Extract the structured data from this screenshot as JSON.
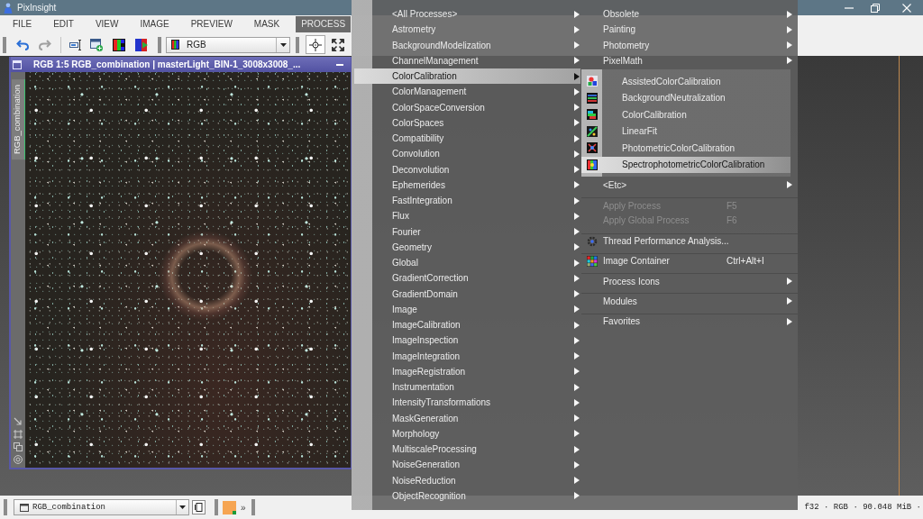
{
  "window": {
    "title": "PixInsight"
  },
  "menu_bar": [
    {
      "label": "FILE",
      "selected": false
    },
    {
      "label": "EDIT",
      "selected": false
    },
    {
      "label": "VIEW",
      "selected": false
    },
    {
      "label": "IMAGE",
      "selected": false
    },
    {
      "label": "PREVIEW",
      "selected": false
    },
    {
      "label": "MASK",
      "selected": false
    },
    {
      "label": "PROCESS",
      "selected": true
    }
  ],
  "toolbar": {
    "undo": {
      "disabled": false
    },
    "redo": {
      "disabled": true
    },
    "channel_selector": {
      "value": "RGB"
    },
    "tools": [
      {
        "selected": true
      },
      {
        "selected": false
      }
    ]
  },
  "image_window": {
    "title": "RGB 1:5 RGB_combination | masterLight_BIN-1_3008x3008_...",
    "side_tab": "RGB_combination"
  },
  "process_menu": {
    "column_1": [
      {
        "label": "<All Processes>",
        "selected": false
      },
      {
        "label": "Astrometry",
        "selected": false
      },
      {
        "label": "BackgroundModelization",
        "selected": false
      },
      {
        "label": "ChannelManagement",
        "selected": false
      },
      {
        "label": "ColorCalibration",
        "selected": true
      },
      {
        "label": "ColorManagement",
        "selected": false
      },
      {
        "label": "ColorSpaceConversion",
        "selected": false
      },
      {
        "label": "ColorSpaces",
        "selected": false
      },
      {
        "label": "Compatibility",
        "selected": false
      },
      {
        "label": "Convolution",
        "selected": false
      },
      {
        "label": "Deconvolution",
        "selected": false
      },
      {
        "label": "Ephemerides",
        "selected": false
      },
      {
        "label": "FastIntegration",
        "selected": false
      },
      {
        "label": "Flux",
        "selected": false
      },
      {
        "label": "Fourier",
        "selected": false
      },
      {
        "label": "Geometry",
        "selected": false
      },
      {
        "label": "Global",
        "selected": false
      },
      {
        "label": "GradientCorrection",
        "selected": false
      },
      {
        "label": "GradientDomain",
        "selected": false
      },
      {
        "label": "Image",
        "selected": false
      },
      {
        "label": "ImageCalibration",
        "selected": false
      },
      {
        "label": "ImageInspection",
        "selected": false
      },
      {
        "label": "ImageIntegration",
        "selected": false
      },
      {
        "label": "ImageRegistration",
        "selected": false
      },
      {
        "label": "Instrumentation",
        "selected": false
      },
      {
        "label": "IntensityTransformations",
        "selected": false
      },
      {
        "label": "MaskGeneration",
        "selected": false
      },
      {
        "label": "Morphology",
        "selected": false
      },
      {
        "label": "MultiscaleProcessing",
        "selected": false
      },
      {
        "label": "NoiseGeneration",
        "selected": false
      },
      {
        "label": "NoiseReduction",
        "selected": false
      },
      {
        "label": "ObjectRecognition",
        "selected": false
      }
    ],
    "column_2": {
      "upper": [
        {
          "label": "Obsolete",
          "kind": "submenu",
          "selected": false,
          "disabled": false,
          "separator_before": false
        },
        {
          "label": "Painting",
          "kind": "submenu",
          "selected": false,
          "disabled": false,
          "separator_before": false
        },
        {
          "label": "Photometry",
          "kind": "submenu",
          "selected": false,
          "disabled": false,
          "separator_before": false
        },
        {
          "label": "PixelMath",
          "kind": "submenu",
          "selected": false,
          "disabled": false,
          "separator_before": false
        }
      ],
      "lower": [
        {
          "label": "<Etc>",
          "kind": "submenu",
          "selected": false,
          "disabled": false,
          "separator_before": false
        },
        {
          "label": "Apply Process",
          "kind": "action",
          "shortcut": "F5",
          "selected": false,
          "disabled": true,
          "separator_before": true
        },
        {
          "label": "Apply Global Process",
          "kind": "action",
          "shortcut": "F6",
          "selected": false,
          "disabled": true,
          "separator_before": false
        },
        {
          "label": "Thread Performance Analysis...",
          "kind": "tool",
          "selected": false,
          "disabled": false,
          "separator_before": true
        },
        {
          "label": "Image Container",
          "kind": "tool",
          "shortcut": "Ctrl+Alt+I",
          "selected": false,
          "disabled": false,
          "separator_before": true
        },
        {
          "label": "Process Icons",
          "kind": "submenu",
          "selected": false,
          "disabled": false,
          "separator_before": true
        },
        {
          "label": "Modules",
          "kind": "submenu",
          "selected": false,
          "disabled": false,
          "separator_before": true
        },
        {
          "label": "Favorites",
          "kind": "submenu",
          "selected": false,
          "disabled": false,
          "separator_before": true
        }
      ]
    },
    "submenu": [
      {
        "label": "AssistedColorCalibration",
        "selected": false
      },
      {
        "label": "BackgroundNeutralization",
        "selected": false
      },
      {
        "label": "ColorCalibration",
        "selected": false
      },
      {
        "label": "LinearFit",
        "selected": false
      },
      {
        "label": "PhotometricColorCalibration",
        "selected": false
      },
      {
        "label": "SpectrophotometricColorCalibration",
        "selected": true
      }
    ]
  },
  "status_bar": {
    "view_selector": {
      "value": "RGB_combination"
    },
    "more": "»",
    "image_info": "f32 · RGB · 90.048 MiB ·"
  }
}
